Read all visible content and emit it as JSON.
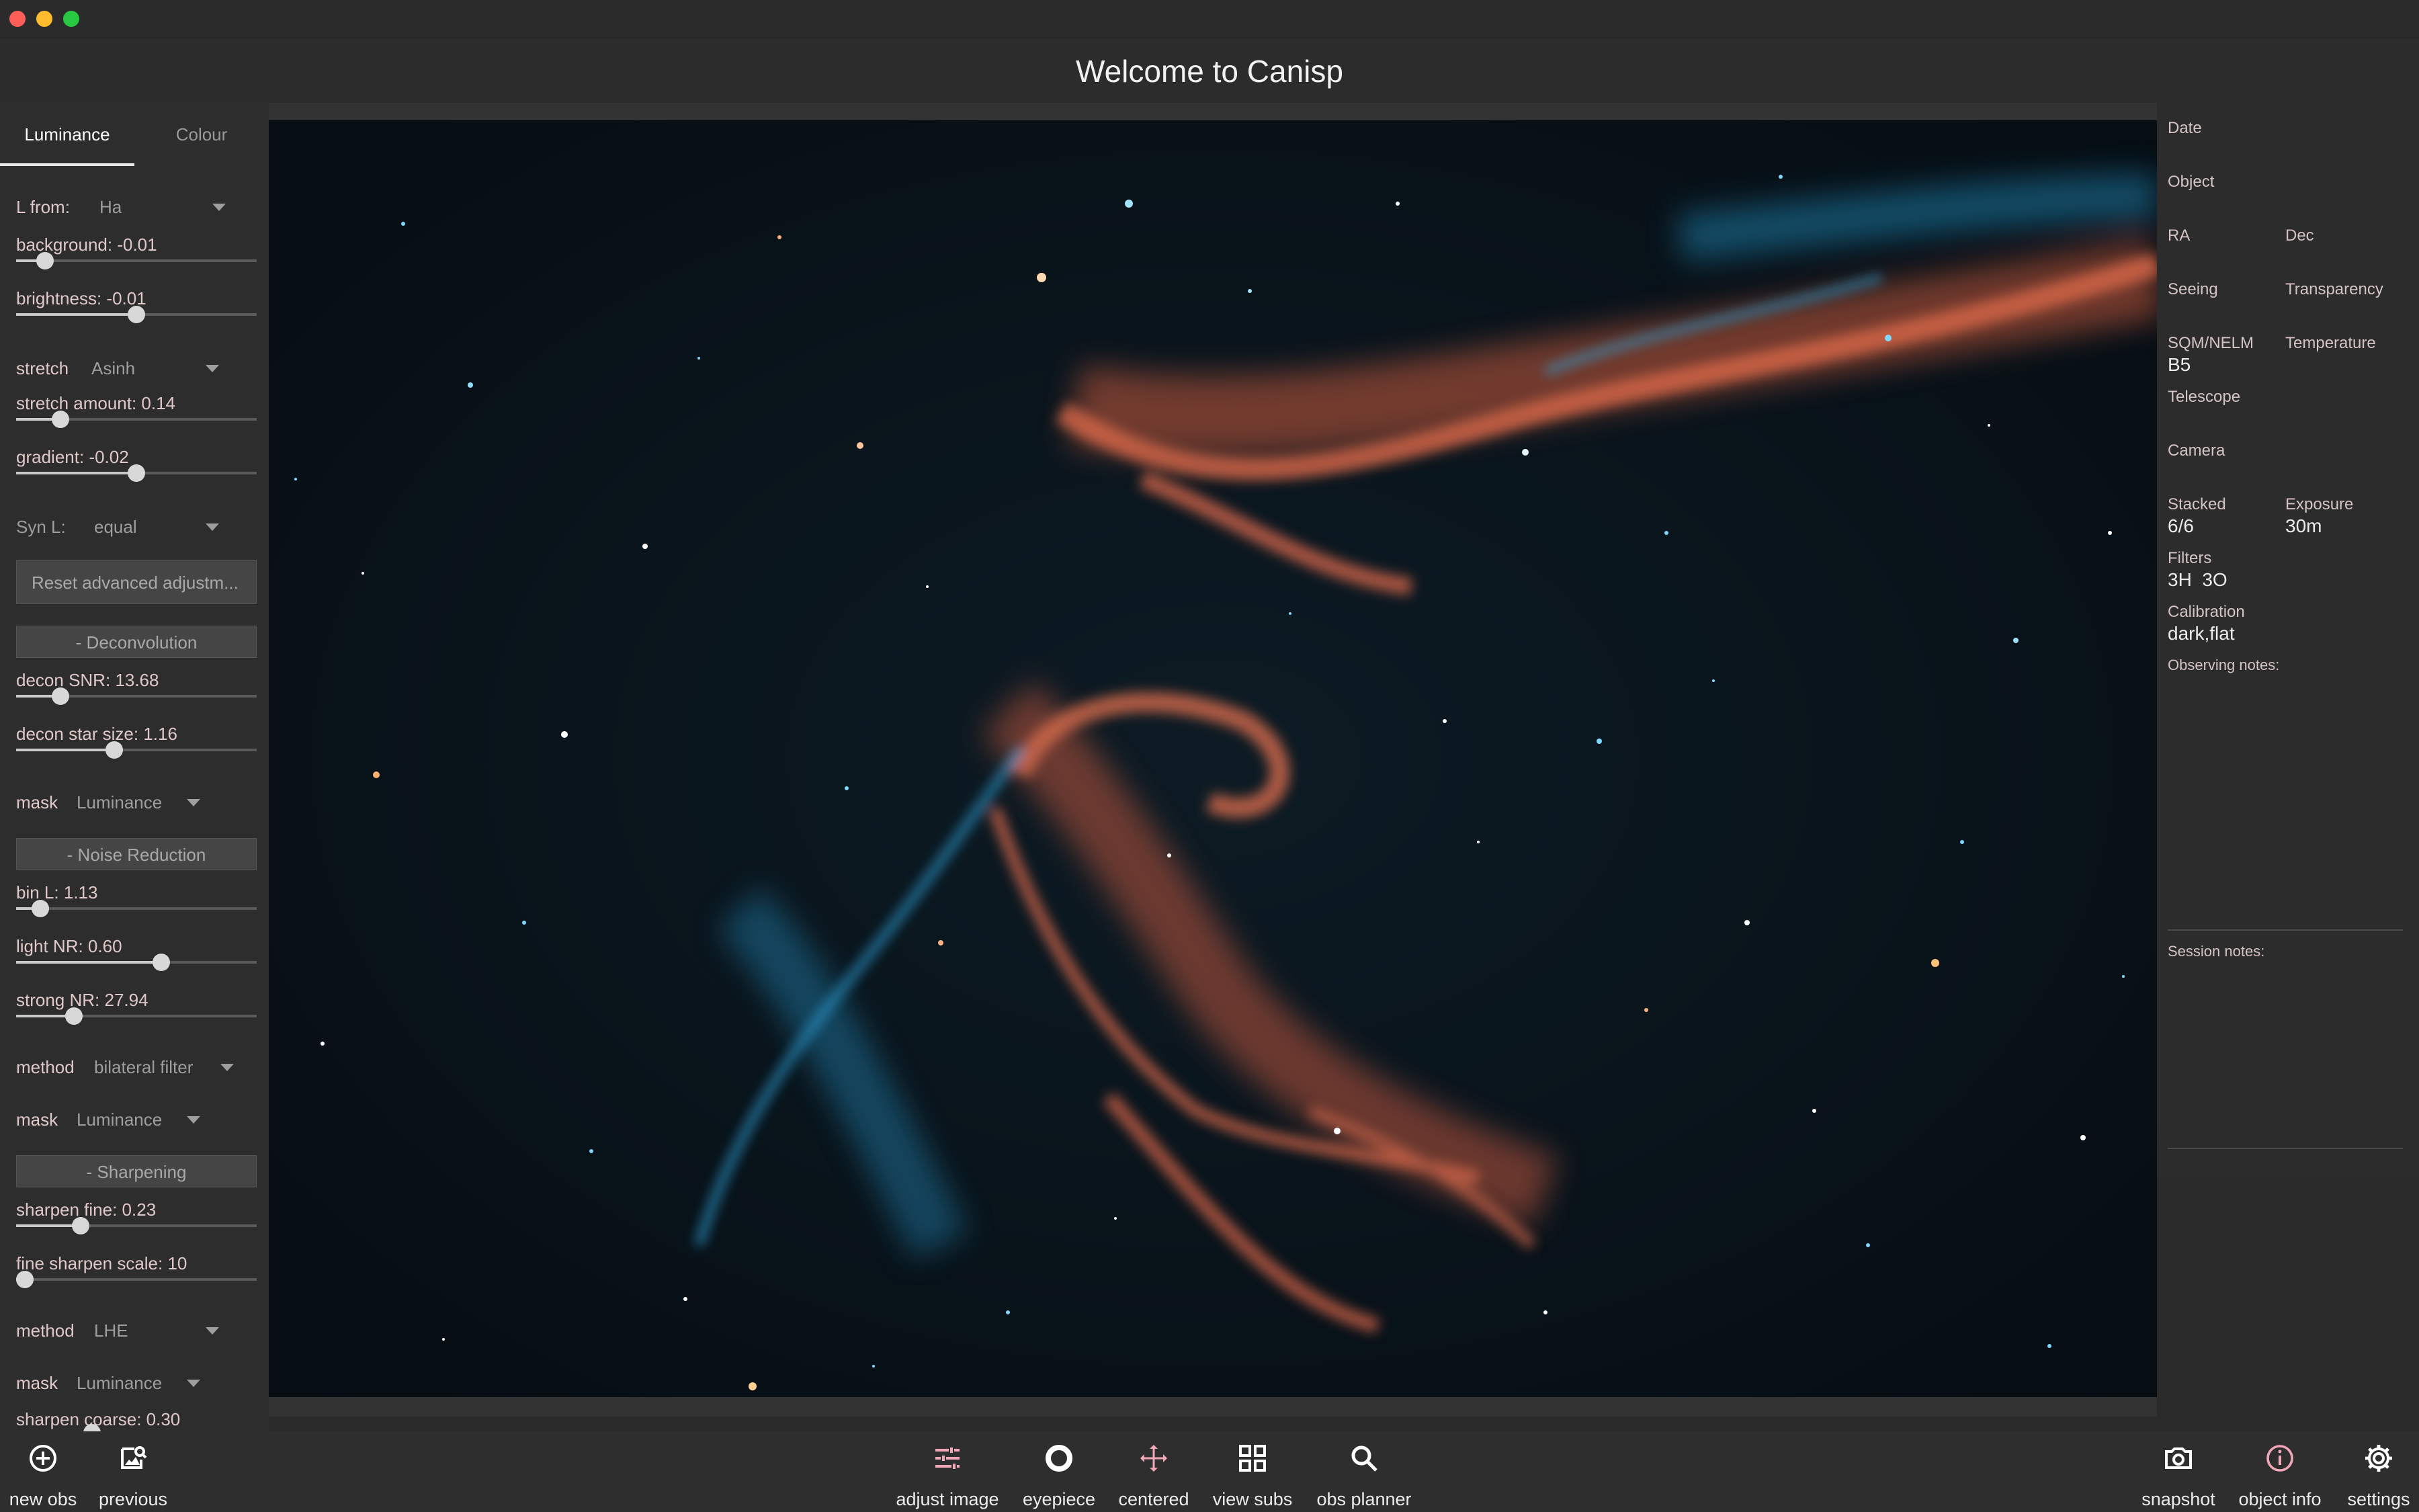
{
  "window": {
    "title": "Welcome to Canisp"
  },
  "left_panel": {
    "tabs": [
      {
        "label": "Luminance"
      },
      {
        "label": "Colour"
      }
    ],
    "l_from": {
      "label": "L from:",
      "value": "Ha"
    },
    "sliders": {
      "background": {
        "label": "background: -0.01",
        "level": 0.09
      },
      "brightness": {
        "label": "brightness: -0.01",
        "level": 0.5
      },
      "stretch_amount": {
        "label": "stretch amount: 0.14",
        "level": 0.16
      },
      "gradient": {
        "label": "gradient: -0.02",
        "level": 0.5
      },
      "decon_snr": {
        "label": "decon SNR: 13.68",
        "level": 0.16
      },
      "decon_star_size": {
        "label": "decon star size: 1.16",
        "level": 0.4
      },
      "bin_l": {
        "label": "bin L: 1.13",
        "level": 0.07
      },
      "light_nr": {
        "label": "light NR: 0.60",
        "level": 0.61
      },
      "strong_nr": {
        "label": "strong NR: 27.94",
        "level": 0.22
      },
      "sharpen_fine": {
        "label": "sharpen fine: 0.23",
        "level": 0.25
      },
      "fine_sharpen_scale": {
        "label": "fine sharpen scale: 10",
        "level": 0.0
      },
      "sharpen_coarse": {
        "label": "sharpen coarse: 0.30",
        "level": 0.3
      }
    },
    "stretch": {
      "label": "stretch",
      "value": "Asinh"
    },
    "syn_l": {
      "label": "Syn L:",
      "value": "equal"
    },
    "reset_button": "Reset advanced adjustm...",
    "deconvolution_button": "- Deconvolution",
    "decon_mask": {
      "label": "mask",
      "value": "Luminance"
    },
    "noise_reduction_button": "- Noise Reduction",
    "nr_method": {
      "label": "method",
      "value": "bilateral filter"
    },
    "nr_mask": {
      "label": "mask",
      "value": "Luminance"
    },
    "sharpening_button": "- Sharpening",
    "sharpen_method": {
      "label": "method",
      "value": "LHE"
    },
    "sharpen_mask": {
      "label": "mask",
      "value": "Luminance"
    }
  },
  "right_panel": {
    "date": "Date",
    "object": "Object",
    "ra": "RA",
    "dec": "Dec",
    "seeing": "Seeing",
    "transparency": "Transparency",
    "sqm": {
      "label": "SQM/NELM",
      "value": "B5"
    },
    "temperature": "Temperature",
    "telescope": "Telescope",
    "camera": "Camera",
    "stacked": {
      "label": "Stacked",
      "value": "6/6"
    },
    "exposure": {
      "label": "Exposure",
      "value": "30m"
    },
    "filters": {
      "label": "Filters",
      "value": "3H  3O"
    },
    "calibration": {
      "label": "Calibration",
      "value": "dark,flat"
    },
    "observing_notes": "Observing notes:",
    "session_notes": "Session notes:"
  },
  "bottom_bar": {
    "new_obs": "new obs",
    "previous": "previous",
    "adjust_image": "adjust image",
    "eyepiece": "eyepiece",
    "centered": "centered",
    "view_subs": "view subs",
    "obs_planner": "obs planner",
    "snapshot": "snapshot",
    "object_info": "object info",
    "settings": "settings"
  },
  "colors": {
    "accent_pink": "#f0a8b8",
    "panel_bg": "#2d2d2d",
    "nebula_red": "#d8684a",
    "nebula_blue": "#2f9ed0"
  },
  "icons": [
    "add-circle-icon",
    "image-search-icon",
    "sliders-icon",
    "eyepiece-ring-icon",
    "crosshair-arrows-icon",
    "grid-icon",
    "magnifier-icon",
    "camera-icon",
    "info-circle-icon",
    "gear-icon"
  ]
}
